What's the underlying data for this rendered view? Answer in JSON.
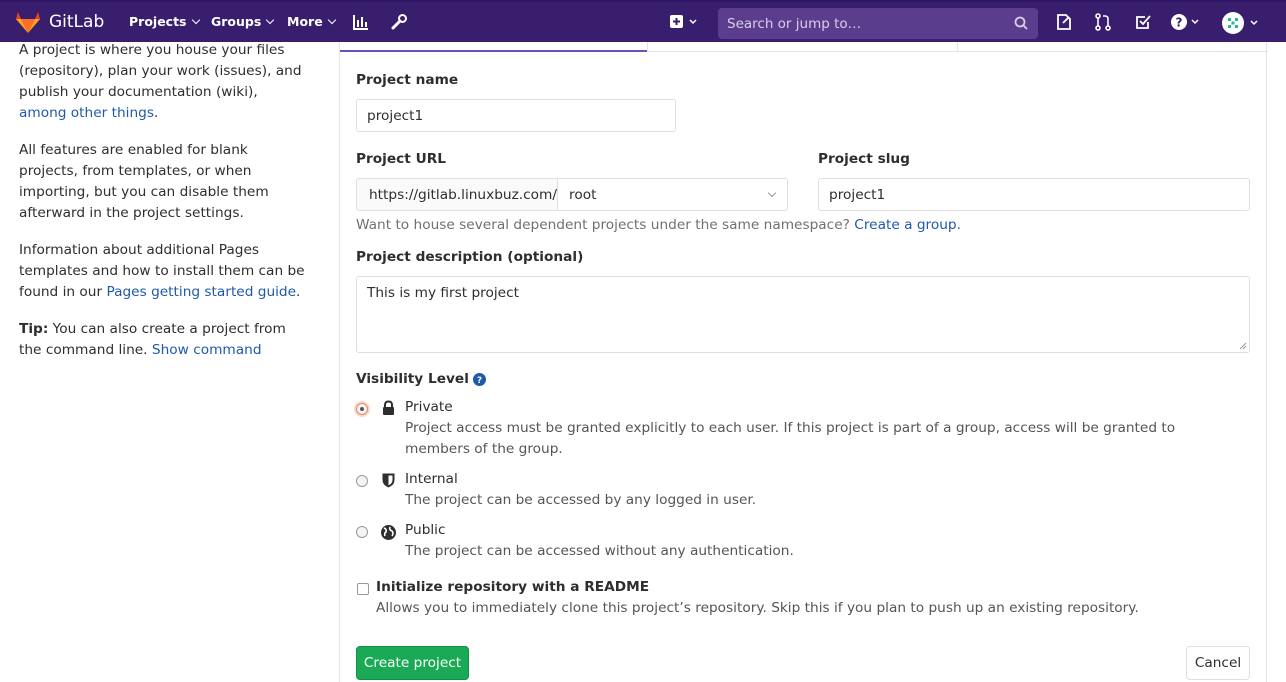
{
  "navbar": {
    "brand": "GitLab",
    "projects": "Projects",
    "groups": "Groups",
    "more": "More",
    "search_placeholder": "Search or jump to…"
  },
  "sidebar": {
    "p1_text": "A project is where you house your files (repository), plan your work (issues), and publish your documentation (wiki),",
    "p1_link": "among other things",
    "p1_end": ".",
    "p2": "All features are enabled for blank projects, from templates, or when importing, but you can disable them afterward in the project settings.",
    "p3_text": "Information about additional Pages templates and how to install them can be found in our",
    "p3_link": "Pages getting started guide",
    "p3_end": ".",
    "tip_label": "Tip:",
    "tip_text": "You can also create a project from the command line.",
    "tip_link": "Show command"
  },
  "form": {
    "project_name_label": "Project name",
    "project_name_value": "project1",
    "project_url_label": "Project URL",
    "url_prefix": "https://gitlab.linuxbuz.com/",
    "namespace": "root",
    "slug_label": "Project slug",
    "slug_value": "project1",
    "namespace_help": "Want to house several dependent projects under the same namespace?",
    "namespace_help_link": "Create a group.",
    "description_label": "Project description (optional)",
    "description_value": "This is my first project",
    "visibility_label": "Visibility Level",
    "visibility": [
      {
        "title": "Private",
        "desc": "Project access must be granted explicitly to each user. If this project is part of a group, access will be granted to members of the group.",
        "checked": true
      },
      {
        "title": "Internal",
        "desc": "The project can be accessed by any logged in user.",
        "checked": false
      },
      {
        "title": "Public",
        "desc": "The project can be accessed without any authentication.",
        "checked": false
      }
    ],
    "readme_label": "Initialize repository with a README",
    "readme_desc": "Allows you to immediately clone this project’s repository. Skip this if you plan to push up an existing repository.",
    "create_button": "Create project",
    "cancel_button": "Cancel"
  }
}
